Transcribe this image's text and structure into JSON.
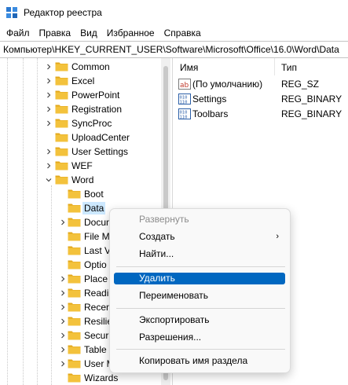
{
  "window": {
    "title": "Редактор реестра"
  },
  "menu": [
    "Файл",
    "Правка",
    "Вид",
    "Избранное",
    "Справка"
  ],
  "address": "Компьютер\\HKEY_CURRENT_USER\\Software\\Microsoft\\Office\\16.0\\Word\\Data",
  "tree": {
    "items": [
      {
        "label": "Common",
        "expander": "collapsed"
      },
      {
        "label": "Excel",
        "expander": "collapsed"
      },
      {
        "label": "PowerPoint",
        "expander": "collapsed"
      },
      {
        "label": "Registration",
        "expander": "collapsed"
      },
      {
        "label": "SyncProc",
        "expander": "collapsed"
      },
      {
        "label": "UploadCenter",
        "expander": "none"
      },
      {
        "label": "User Settings",
        "expander": "collapsed"
      },
      {
        "label": "WEF",
        "expander": "collapsed"
      },
      {
        "label": "Word",
        "expander": "expanded"
      },
      {
        "label": "Boot",
        "expander": "none"
      },
      {
        "label": "Data",
        "expander": "none",
        "selected": true
      },
      {
        "label": "Docum",
        "expander": "collapsed"
      },
      {
        "label": "File M",
        "expander": "none"
      },
      {
        "label": "Last V",
        "expander": "none"
      },
      {
        "label": "Optio",
        "expander": "none"
      },
      {
        "label": "Place",
        "expander": "collapsed"
      },
      {
        "label": "Readi",
        "expander": "collapsed"
      },
      {
        "label": "Recen",
        "expander": "collapsed"
      },
      {
        "label": "Resilie",
        "expander": "collapsed"
      },
      {
        "label": "Securi",
        "expander": "collapsed"
      },
      {
        "label": "Table",
        "expander": "collapsed"
      },
      {
        "label": "User M",
        "expander": "collapsed"
      },
      {
        "label": "Wizards",
        "expander": "none"
      }
    ]
  },
  "values": {
    "headers": {
      "name": "Имя",
      "type": "Тип"
    },
    "rows": [
      {
        "name": "(По умолчанию)",
        "type": "REG_SZ",
        "icon": "string-value-icon"
      },
      {
        "name": "Settings",
        "type": "REG_BINARY",
        "icon": "binary-value-icon"
      },
      {
        "name": "Toolbars",
        "type": "REG_BINARY",
        "icon": "binary-value-icon"
      }
    ]
  },
  "context_menu": {
    "expand": "Развернуть",
    "create": "Создать",
    "find": "Найти...",
    "delete": "Удалить",
    "rename": "Переименовать",
    "export": "Экспортировать",
    "permissions": "Разрешения...",
    "copy_key_name": "Копировать имя раздела"
  },
  "colors": {
    "folder": "#f3c23c",
    "folder_dark": "#e3a81d",
    "selection": "#cce8ff",
    "menu_highlight": "#0067c0"
  }
}
